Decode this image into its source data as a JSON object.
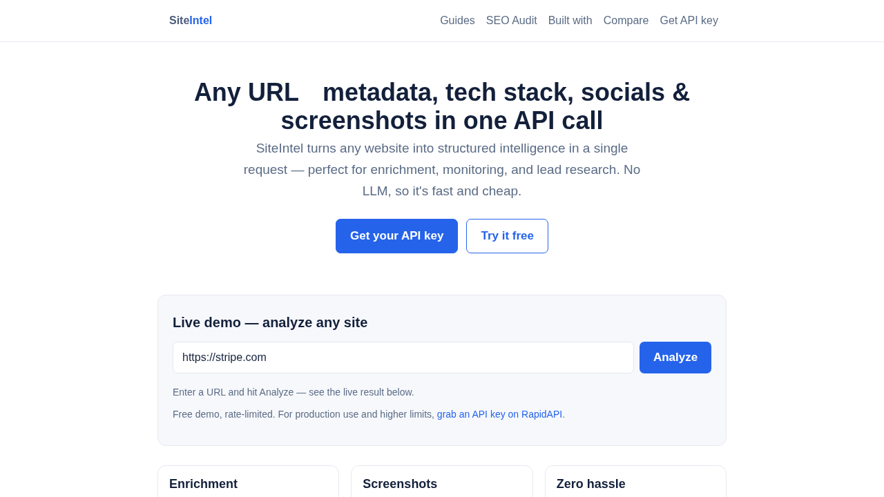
{
  "header": {
    "logo": [
      {
        "text": "Site",
        "kind": "plain"
      },
      {
        "text": "Intel",
        "kind": "accent"
      }
    ],
    "nav": [
      "Guides",
      "SEO Audit",
      "Built with",
      "Compare",
      "Get API key"
    ]
  },
  "hero": {
    "headline": {
      "lead": "Any URL",
      "rest": "metadata, tech stack, socials & screenshots in one API call"
    },
    "subtitle": "SiteIntel turns any website into structured intelligence in a single request — perfect for enrichment, monitoring, and lead research. No LLM, so it's fast and cheap.",
    "buttons": [
      {
        "label": "Get your API key",
        "kind": "primary"
      },
      {
        "label": "Try it free",
        "kind": "outline"
      }
    ]
  },
  "demo": {
    "title": "Live demo — analyze any site",
    "input": {
      "value": "https://stripe.com"
    },
    "button": "Analyze",
    "hint": "Enter a URL and hit Analyze — see the live result below.",
    "note": {
      "text": "Free demo, rate-limited. For production use and higher limits,",
      "link": "grab an API key on RapidAPI",
      "after": "."
    }
  },
  "features": [
    {
      "title": "Enrichment"
    },
    {
      "title": "Screenshots"
    },
    {
      "title": "Zero hassle"
    }
  ]
}
